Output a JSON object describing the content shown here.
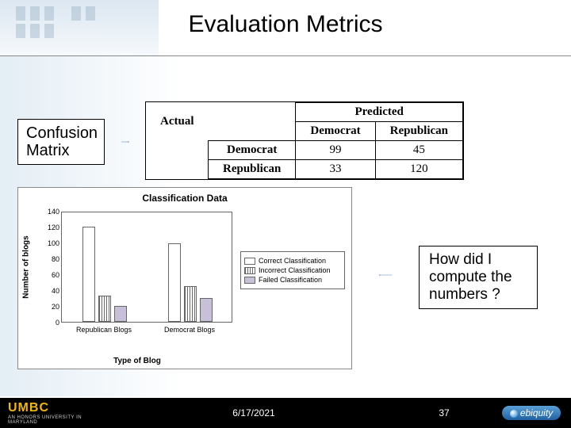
{
  "title": "Evaluation Metrics",
  "confusion_label": "Confusion Matrix",
  "confusion": {
    "header_predicted": "Predicted",
    "header_actual": "Actual",
    "col1": "Democrat",
    "col2": "Republican",
    "row1": "Democrat",
    "row2": "Republican",
    "c11": "99",
    "c12": "45",
    "c21": "33",
    "c22": "120"
  },
  "chart_data": {
    "type": "bar",
    "title": "Classification Data",
    "xlabel": "Type of Blog",
    "ylabel": "Number of blogs",
    "ylim": [
      0,
      140
    ],
    "yticks": [
      0,
      20,
      40,
      60,
      80,
      100,
      120,
      140
    ],
    "categories": [
      "Republican Blogs",
      "Democrat   Blogs"
    ],
    "series": [
      {
        "name": "Correct Classification",
        "values": [
          120,
          99
        ]
      },
      {
        "name": "Incorrect Classification",
        "values": [
          33,
          45
        ]
      },
      {
        "name": "Failed Classification",
        "values": [
          20,
          30
        ]
      }
    ]
  },
  "question": "How did I compute the numbers ?",
  "footer": {
    "logo_main": "UMBC",
    "logo_sub": "AN HONORS UNIVERSITY IN MARYLAND",
    "date": "6/17/2021",
    "page": "37",
    "ebiq": "ebiquity"
  }
}
